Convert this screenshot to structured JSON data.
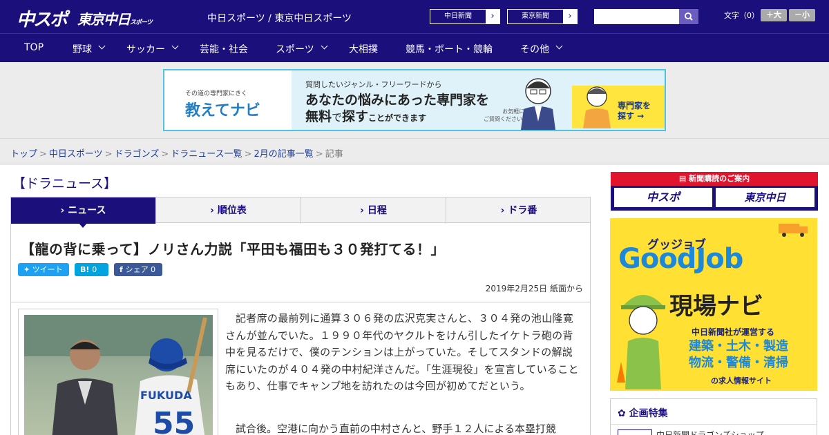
{
  "header": {
    "logo_chuspo": "中スポ",
    "logo_tokyo": "東京中日",
    "logo_tokyo_small": "スポーツ",
    "site_title": "中日スポーツ / 東京中日スポーツ",
    "link_chunichi": "中日新聞",
    "link_tokyo": "東京新聞",
    "font_label": "文字（0）",
    "font_larger": "＋大",
    "font_smaller": "－小"
  },
  "nav": [
    "TOP",
    "野球",
    "サッカー",
    "芸能・社会",
    "スポーツ",
    "大相撲",
    "競馬・ボート・競輪",
    "その他"
  ],
  "banner": {
    "small": "その道の専門家にきく",
    "brand": "教えてナビ",
    "line1": "質問したいジャンル・フリーワードから",
    "line2": "あなたの悩みにあった専門家を",
    "line3a": "無料",
    "line3b": "で",
    "line3c": "探す",
    "line3d": "ことができます",
    "note1": "お気軽に",
    "note2": "ご質問ください!",
    "cta1": "専門家を",
    "cta2": "探す →"
  },
  "breadcrumb": [
    "トップ",
    "中日スポーツ",
    "ドラゴンズ",
    "ドラニュース一覧",
    "2月の記事一覧",
    "記事"
  ],
  "section_title": "【ドラニュース】",
  "tabs": [
    "ニュース",
    "順位表",
    "日程",
    "ドラ番"
  ],
  "article": {
    "headline": "【龍の背に乗って】ノリさん力説「平田も福田も３０発打てる！」",
    "tweet": "ツイート",
    "hatena_count": "0",
    "share": "シェア",
    "share_count": "0",
    "date": "2019年2月25日 紙面から",
    "para1": "記者席の最前列に通算３０６発の広沢克実さんと、３０４発の池山隆寛さんが並んでいた。１９９０年代のヤクルトをけん引したイケトラ砲の背中を見るだけで、僕のテンションは上がっていた。そしてスタンドの解説席にいたのが４０４発の中村紀洋さんだ。「生涯現役」を宣言していることもあり、仕事でキャンプ地を訪れたのは今回が初めてだという。",
    "para2": "試合後。空港に向かう直前の中村さんと、野手１２人による本塁打競",
    "photo_name": "FUKUDA",
    "photo_number": "55"
  },
  "side": {
    "sub_head": "新聞購読のご案内",
    "sub_chuspo": "中スポ",
    "sub_tokyo": "東京中日",
    "gj_kana": "グッジョブ",
    "gj_title": "GoodJob",
    "gj_sub": "現場ナビ",
    "gj_t1": "中日新聞社が運営する",
    "gj_t2a": "建築・土木・製造",
    "gj_t2b": "物流・警備・清掃",
    "gj_t3": "の求人情報サイト",
    "feature_head": "企画特集",
    "feature_item": "中日新聞ドラゴンズショップ"
  },
  "colors": {
    "navy": "#1b0f7c",
    "red": "#e0142d",
    "yellow": "#ffe033",
    "twitter": "#1da1f2",
    "facebook": "#3b5998"
  }
}
